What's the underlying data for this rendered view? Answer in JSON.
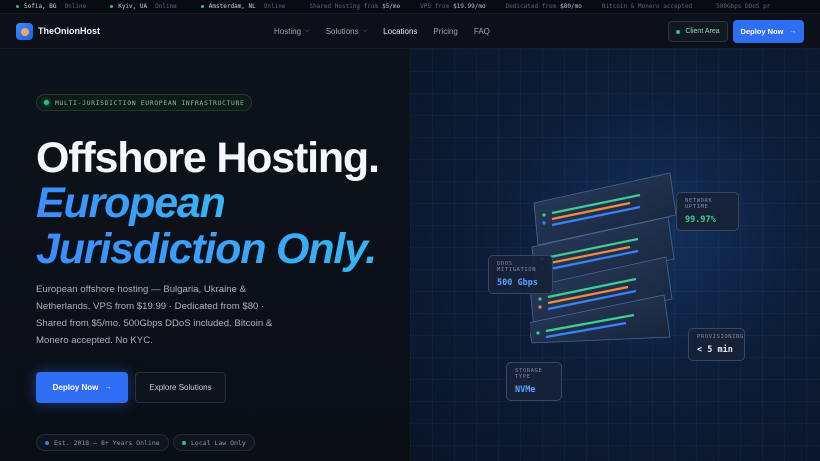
{
  "ticker": [
    {
      "city": "Sofia, BG",
      "status": "Online"
    },
    {
      "city": "Kyiv, UA",
      "status": "Online"
    },
    {
      "city": "Amsterdam, NL",
      "status": "Online"
    },
    {
      "text": "Shared Hosting from",
      "value": "$5/mo"
    },
    {
      "text": "VPS from",
      "value": "$19.99/mo"
    },
    {
      "text": "Dedicated from",
      "value": "$80/mo"
    },
    {
      "text": "Bitcoin & Monero accepted"
    },
    {
      "text": "500Gbps DDoS pr"
    }
  ],
  "nav": {
    "brand": "TheOnionHost",
    "links": [
      "Hosting",
      "Solutions",
      "Locations",
      "Pricing",
      "FAQ"
    ],
    "active": "Locations",
    "client_area": "Client Area",
    "deploy": "Deploy Now",
    "deploy_arrow": "→"
  },
  "hero": {
    "badge": "MULTI-JURISDICTION EUROPEAN INFRASTRUCTURE",
    "title_line1": "Offshore Hosting.",
    "title_line2": "European",
    "title_line3": "Jurisdiction Only.",
    "description": "European offshore hosting — Bulgaria, Ukraine & Netherlands. VPS from $19.99 · Dedicated from $80 · Shared from $5/mo. 500Gbps DDoS included. Bitcoin & Monero accepted. No KYC.",
    "cta_primary": "Deploy Now",
    "cta_arrow": "→",
    "cta_secondary": "Explore Solutions",
    "pills": [
      "Est. 2018 — 8+ Years Online",
      "Local Law Only"
    ]
  },
  "stats": {
    "uptime": {
      "label": "NETWORK UPTIME",
      "value": "99.97%"
    },
    "ddos": {
      "label": "DDOS MITIGATION",
      "value": "500 Gbps"
    },
    "provisioning": {
      "label": "PROVISIONING",
      "value": "< 5 min"
    },
    "storage": {
      "label": "STORAGE TYPE",
      "value": "NVMe"
    }
  },
  "colors": {
    "accent_blue": "#2f6ef2",
    "status_green": "#2ec27e",
    "gradient_start": "#3c8cff",
    "gradient_end": "#38b6f2",
    "bar_green": "#3ecf8e",
    "bar_orange": "#f08c3c",
    "bar_blue": "#3c82f6"
  }
}
